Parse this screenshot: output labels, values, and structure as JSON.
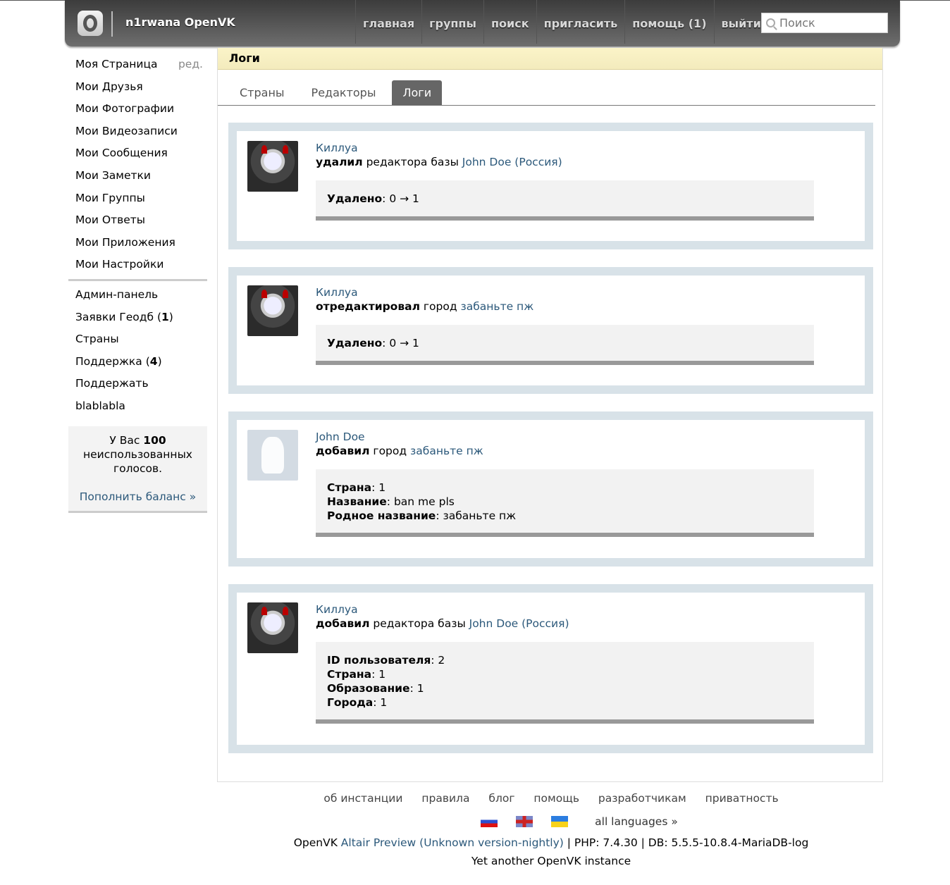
{
  "header": {
    "site_title": "n1rwana OpenVK",
    "nav": [
      "главная",
      "группы",
      "поиск",
      "пригласить",
      "помощь (1)",
      "выйти"
    ],
    "search_placeholder": "Поиск"
  },
  "sidebar": {
    "items": [
      "Моя Страница",
      "Мои Друзья",
      "Мои Фотографии",
      "Мои Видеозаписи",
      "Мои Сообщения",
      "Мои Заметки",
      "Мои Группы",
      "Мои Ответы",
      "Мои Приложения",
      "Мои Настройки"
    ],
    "edit_label": "ред.",
    "admin_items": [
      {
        "label": "Админ-панель"
      },
      {
        "label": "Заявки Геодб",
        "count": "1"
      },
      {
        "label": "Страны"
      },
      {
        "label": "Поддержка",
        "count": "4"
      },
      {
        "label": "Поддержать"
      },
      {
        "label": "blablabla"
      }
    ],
    "votes": {
      "prefix": "У Вас",
      "count": "100",
      "suffix": "неиспользованных голосов.",
      "topup": "Пополнить баланс »"
    }
  },
  "page": {
    "title": "Логи",
    "tabs": [
      "Страны",
      "Редакторы",
      "Логи"
    ],
    "active_tab": "Логи"
  },
  "entries": [
    {
      "user": "Киллуа",
      "avatar": "killua",
      "verb": "удалил",
      "object": "редактора базы",
      "target": "John Doe (Россия)",
      "fields": [
        {
          "k": "Удалено",
          "v": "0 → 1"
        }
      ]
    },
    {
      "user": "Киллуа",
      "avatar": "killua",
      "verb": "отредактировал",
      "object": "город",
      "target": "забаньте пж",
      "fields": [
        {
          "k": "Удалено",
          "v": "0 → 1"
        }
      ]
    },
    {
      "user": "John Doe",
      "avatar": "default",
      "verb": "добавил",
      "object": "город",
      "target": "забаньте пж",
      "fields": [
        {
          "k": "Страна",
          "v": "1"
        },
        {
          "k": "Название",
          "v": "ban me pls"
        },
        {
          "k": "Родное название",
          "v": "забаньте пж"
        }
      ]
    },
    {
      "user": "Киллуа",
      "avatar": "killua",
      "verb": "добавил",
      "object": "редактора базы",
      "target": "John Doe (Россия)",
      "fields": [
        {
          "k": "ID пользователя",
          "v": "2"
        },
        {
          "k": "Страна",
          "v": "1"
        },
        {
          "k": "Образование",
          "v": "1"
        },
        {
          "k": "Города",
          "v": "1"
        }
      ]
    }
  ],
  "footer": {
    "links": [
      "об инстанции",
      "правила",
      "блог",
      "помощь",
      "разработчикам",
      "приватность"
    ],
    "all_languages": "all languages »",
    "version_prefix": "OpenVK",
    "version_link": "Altair Preview (Unknown version-nightly)",
    "version_suffix": "| PHP: 7.4.30 | DB: 5.5.5-10.8.4-MariaDB-log",
    "instance": "Yet another OpenVK instance"
  }
}
